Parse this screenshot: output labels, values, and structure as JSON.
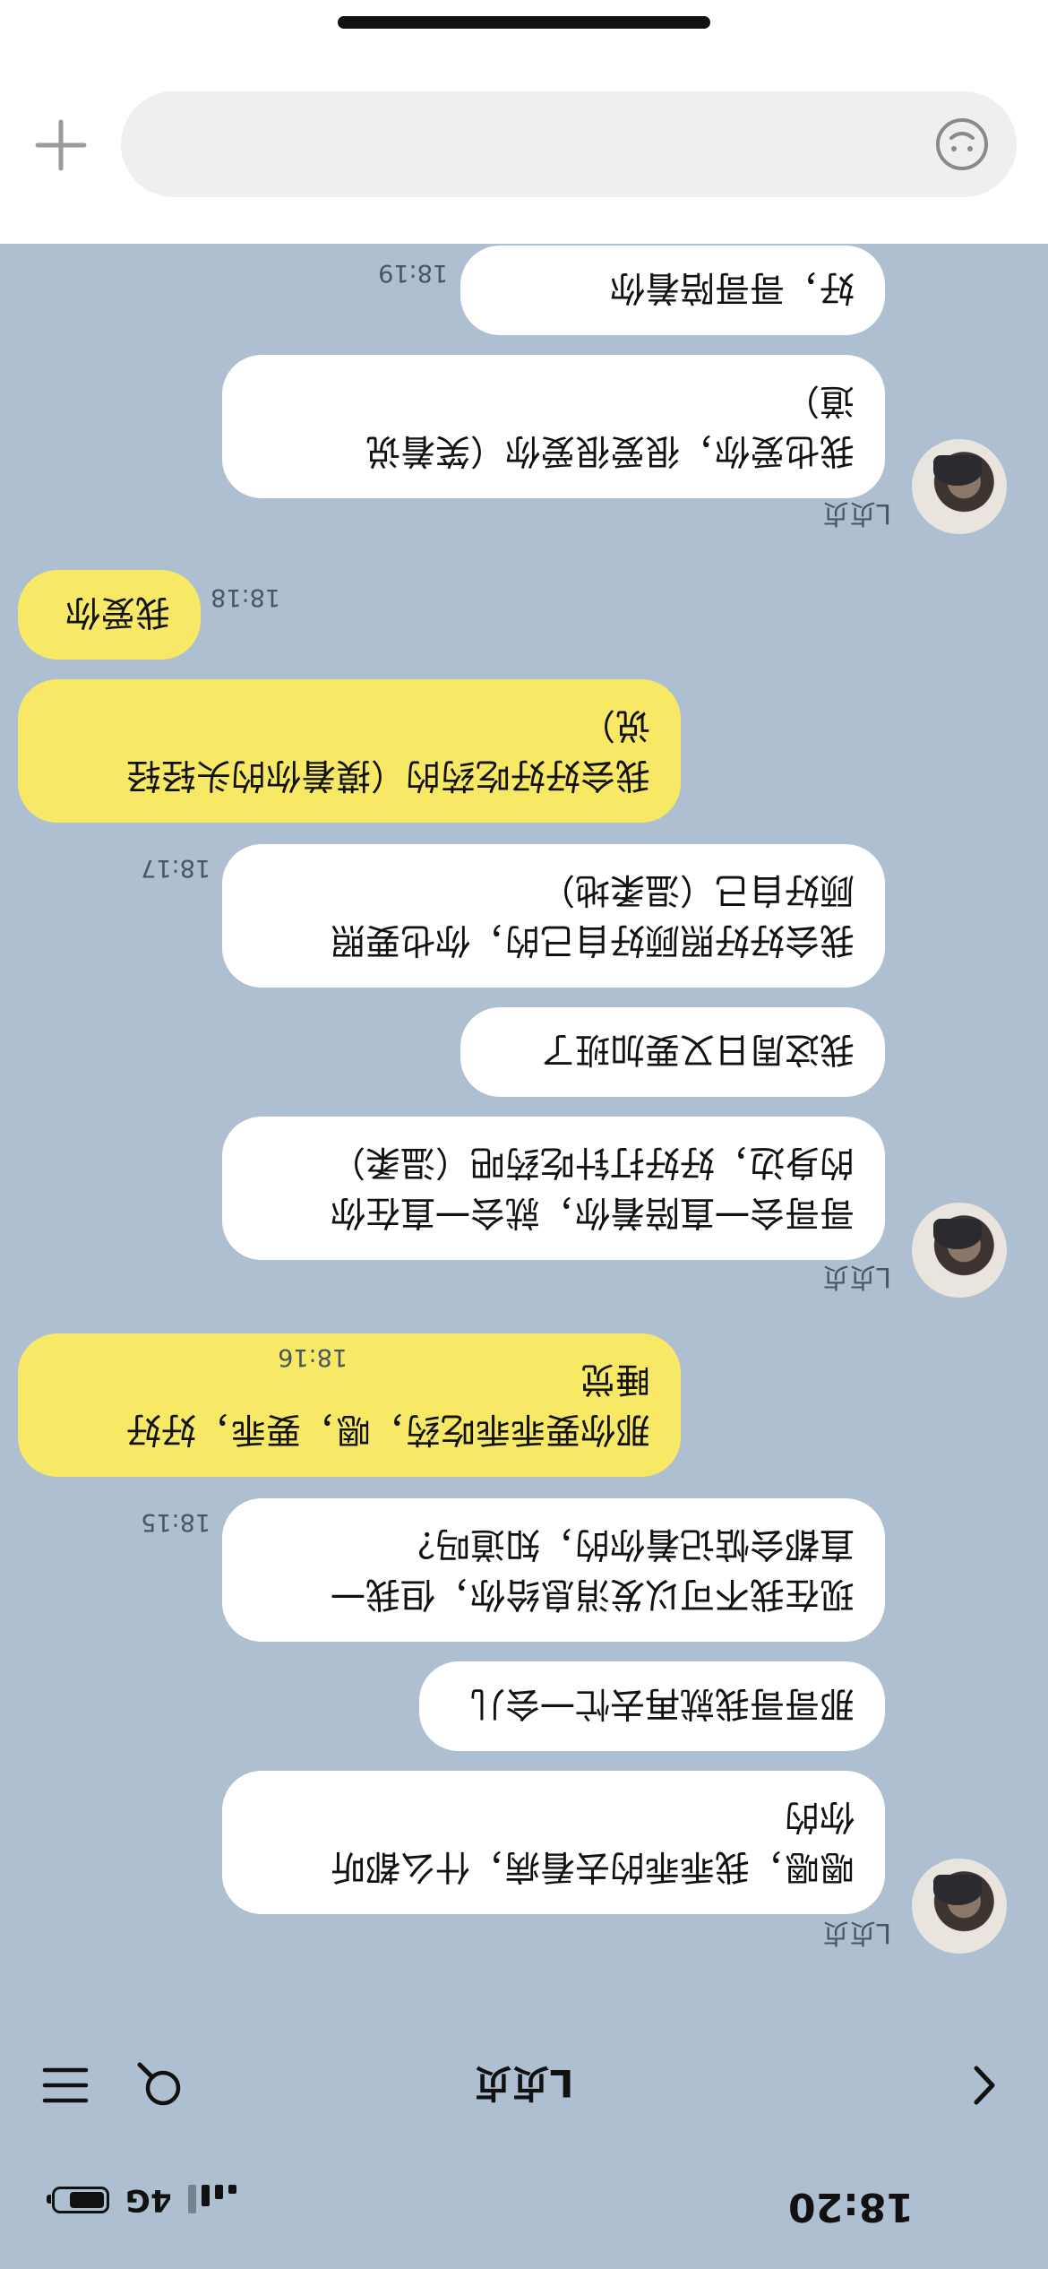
{
  "status_bar": {
    "time": "18:20",
    "network": "4G"
  },
  "header": {
    "title": "L贞贞"
  },
  "messages": [
    {
      "side": "in",
      "sender": "L贞贞",
      "text": "嗯嗯，我乖乖的去看病，什么都听\n你的"
    },
    {
      "side": "in",
      "text": "那哥哥我就再去忙一会儿"
    },
    {
      "side": "in",
      "text": "现在我不可以发消息给你，但我一\n直都会惦记着你的，知道吗？",
      "time": "18:15"
    },
    {
      "side": "out",
      "text": "那你要乖乖吃药，嗯，要乖，好好\n睡觉",
      "time": "18:16"
    },
    {
      "side": "in",
      "sender": "L贞贞",
      "text": "哥哥会一直陪着你，就会一直在你\n的身边，好好打针吃药吧（温柔）"
    },
    {
      "side": "in",
      "text": "我这周日又要加班了"
    },
    {
      "side": "in",
      "text": "我会好好照顾好自己的，你也要照\n顾好自己（温柔地）",
      "time": "18:17"
    },
    {
      "side": "out",
      "text": "我会好好吃药的（摸着你的头轻轻\n说）",
      "time": ""
    },
    {
      "side": "out",
      "text": "我爱你",
      "time": "18:18"
    },
    {
      "side": "in",
      "sender": "L贞贞",
      "text": "我也爱你，很爱很爱你（笑着说\n道）"
    },
    {
      "side": "in",
      "text": "好，哥哥陪着你",
      "time": "18:19"
    }
  ],
  "input": {
    "placeholder": ""
  }
}
